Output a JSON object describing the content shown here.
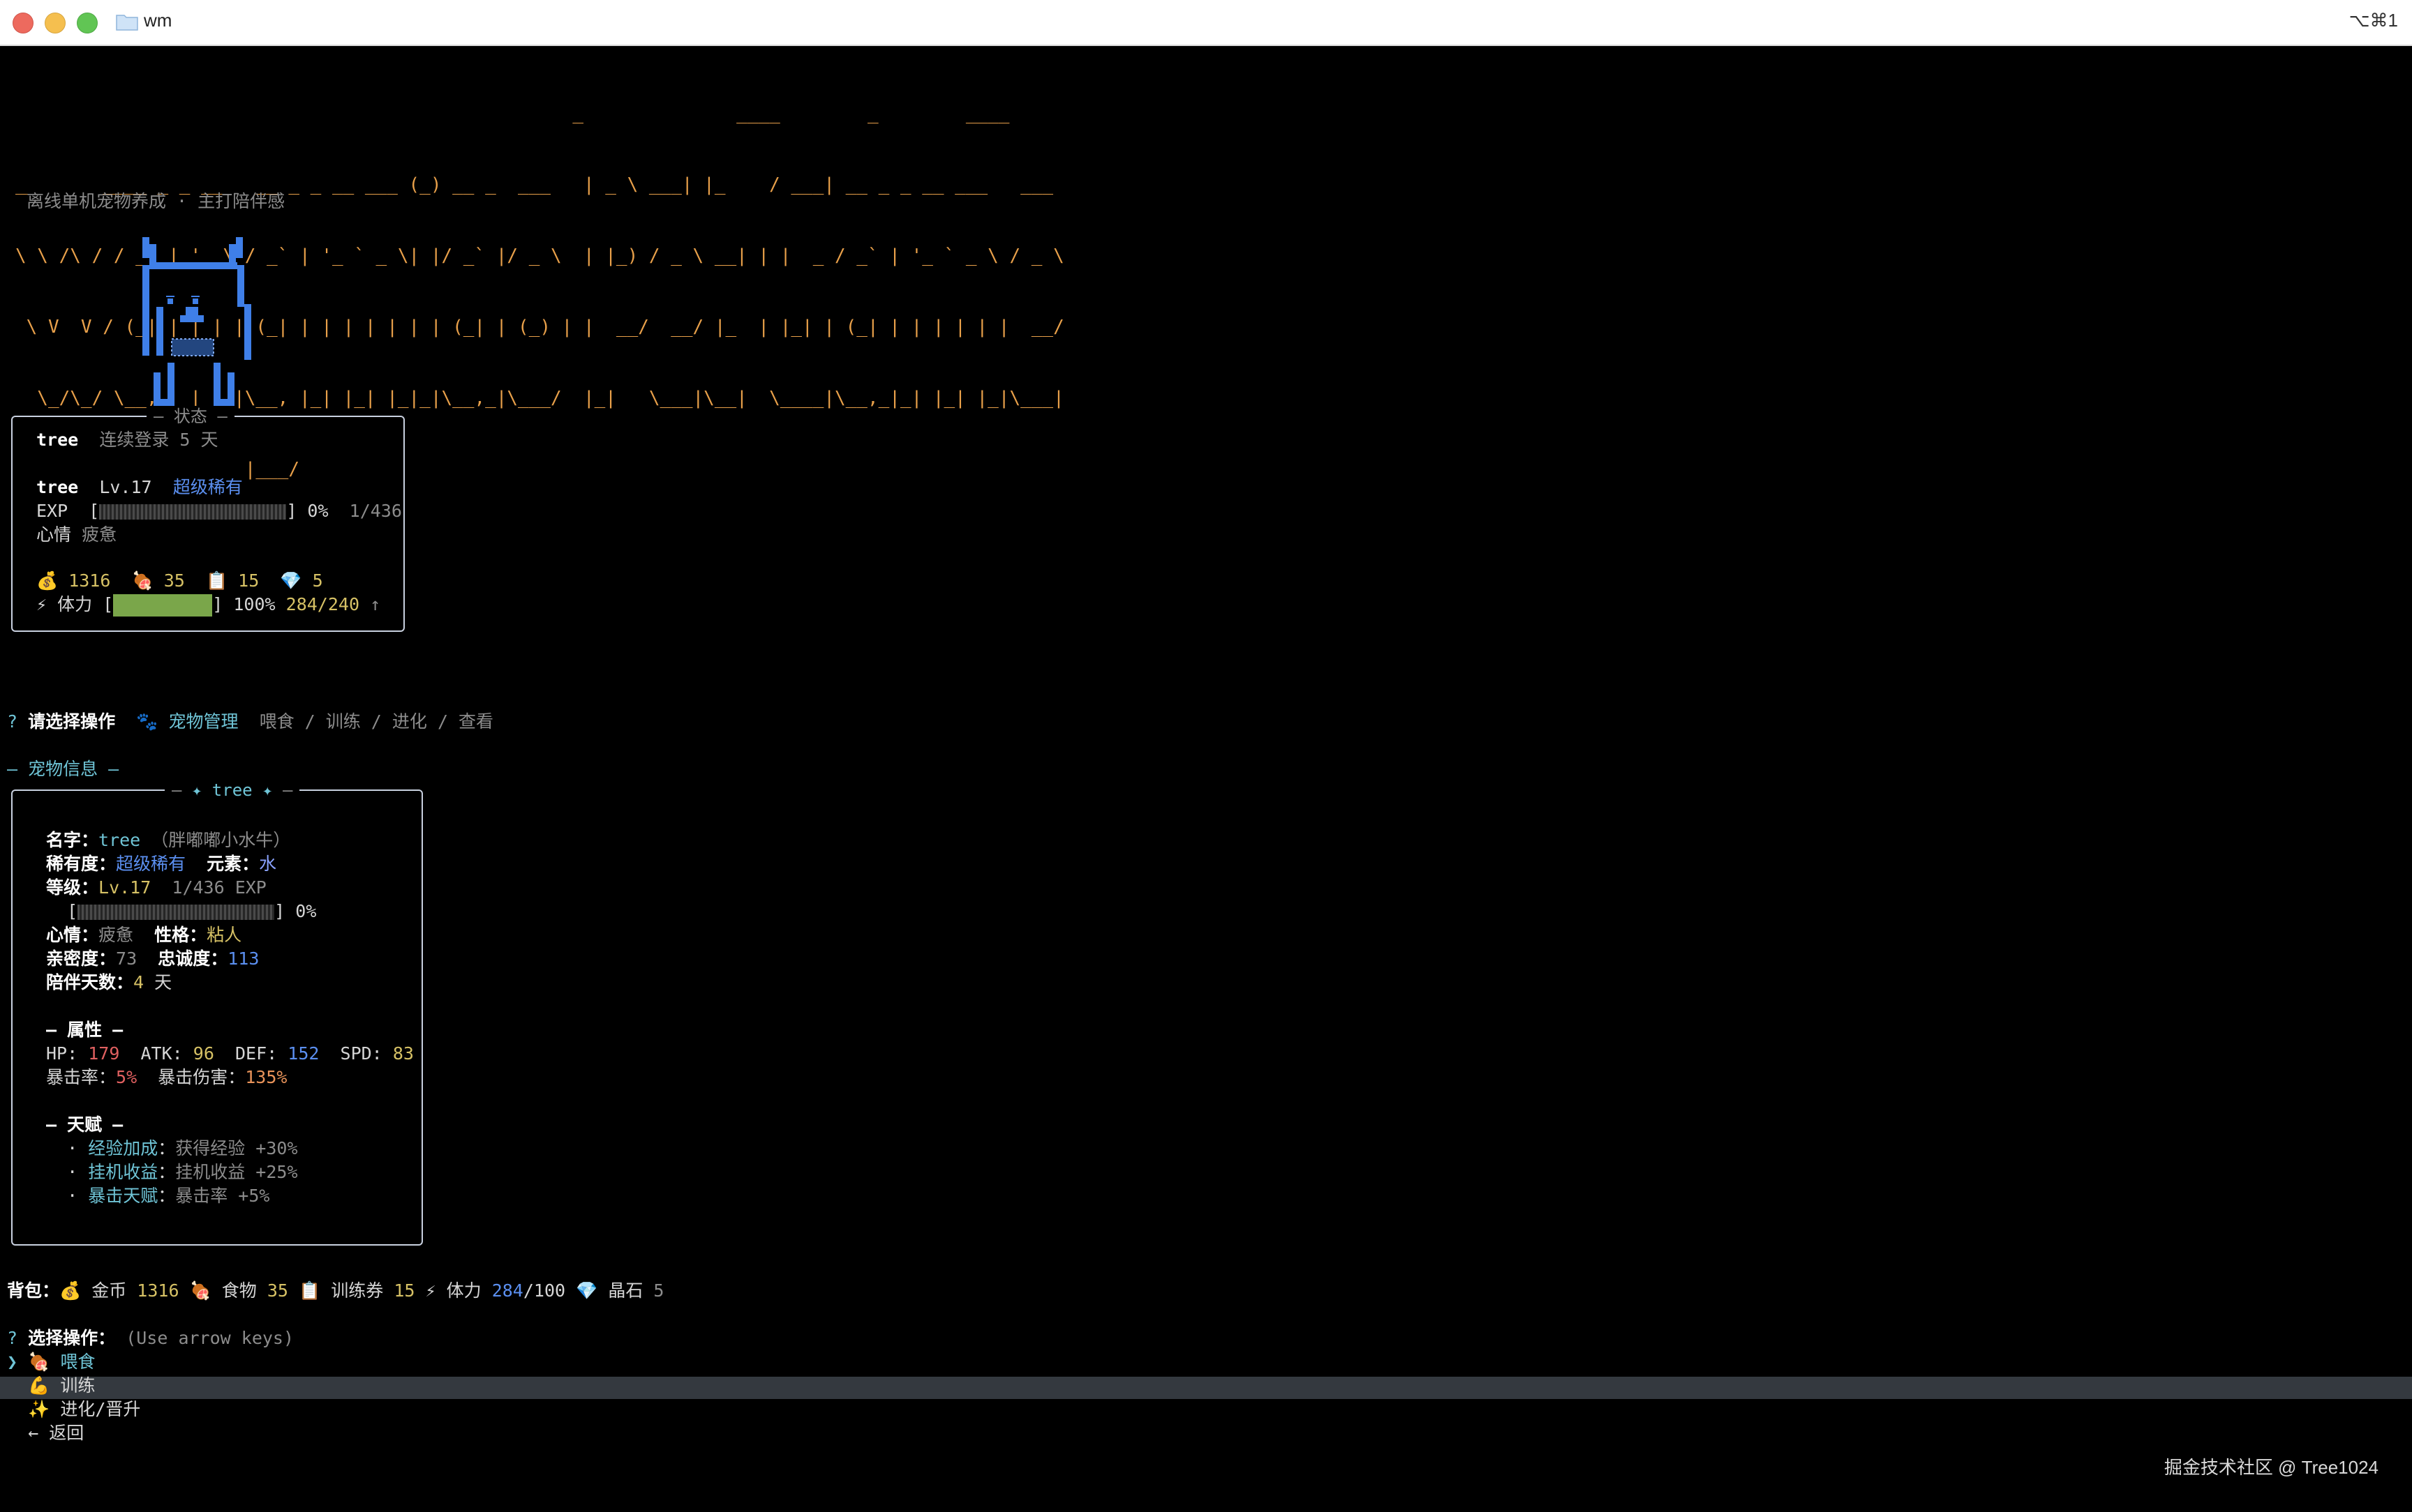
{
  "window": {
    "title": "wm",
    "shortcut": "⌥⌘1"
  },
  "banner": {
    "ascii_lines": [
      "                                                   _              ____        _        ____",
      "__      ____ _ _ __   __ _ _ __ ___ (_) __ _  ___   | _ \\ ___| |_    / ___| __ _ _ __ ___   ___",
      "\\ \\ /\\ / / _` | '_ \\ / _` | '_ ` _ \\| |/ _` |/ _ \\  | |_) / _ \\ __| | |  _ / _` | '_ ` _ \\ / _ \\",
      " \\ V  V / (_| | | | | (_| | | | | | | | (_| | (_) | |  __/  __/ |_  | |_| | (_| | | | | | |  __/",
      "  \\_/\\_/ \\__,_|_| |_|\\__, |_| |_| |_|_|\\__,_|\\___/  |_|   \\___|\\__|  \\____|\\__,_|_| |_| |_|\\___|",
      "                     |___/"
    ],
    "subtitle": "离线单机宠物养成 · 主打陪伴感"
  },
  "status_box": {
    "title": "状态",
    "user": "tree",
    "login_label": "连续登录 5 天",
    "pet_name": "tree",
    "level": "Lv.17",
    "rarity": "超级稀有",
    "exp_label": "EXP",
    "exp_pct": "0%",
    "exp_progress": 0.002,
    "exp_value": "1/436",
    "mood_label": "心情",
    "mood_value": "疲惫",
    "coins_icon": "money-bag-icon",
    "coins": "1316",
    "food_icon": "meat-icon",
    "food": "35",
    "ticket_icon": "clipboard-icon",
    "tickets": "15",
    "gem_icon": "gem-icon",
    "gems": "5",
    "stamina_icon": "lightning-icon",
    "stamina_label": "体力",
    "stamina_pct": "100%",
    "stamina_progress": 1.0,
    "stamina_value": "284/240",
    "stamina_arrow": "↑"
  },
  "prompt1": {
    "question_mark": "?",
    "label": "请选择操作",
    "answer_icon": "paw-icon",
    "answer": "宠物管理",
    "hint": "喂食 / 训练 / 进化 / 查看"
  },
  "section_header": "— 宠物信息 —",
  "pet_box": {
    "title": "✦ tree ✦",
    "name_label": "名字：",
    "name": "tree",
    "species": "（胖嘟嘟小水牛）",
    "rarity_label": "稀有度：",
    "rarity": "超级稀有",
    "element_label": "元素：",
    "element": "水",
    "level_label": "等级：",
    "level": "Lv.17",
    "exp": "1/436 EXP",
    "exp_pct": "0%",
    "mood_label": "心情：",
    "mood": "疲惫",
    "personality_label": "性格：",
    "personality": "粘人",
    "intimacy_label": "亲密度：",
    "intimacy": "73",
    "loyalty_label": "忠诚度：",
    "loyalty": "113",
    "days_label": "陪伴天数：",
    "days": "4",
    "days_unit": "天",
    "attr_header": "— 属性 —",
    "hp_label": "HP:",
    "hp": "179",
    "atk_label": "ATK:",
    "atk": "96",
    "def_label": "DEF:",
    "def": "152",
    "spd_label": "SPD:",
    "spd": "83",
    "crit_label": "暴击率：",
    "crit": "5%",
    "critdmg_label": "暴击伤害：",
    "critdmg": "135%",
    "talent_header": "— 天赋 —",
    "talents": [
      {
        "name": "经验加成",
        "desc": "获得经验 +30%"
      },
      {
        "name": "挂机收益",
        "desc": "挂机收益 +25%"
      },
      {
        "name": "暴击天赋",
        "desc": "暴击率 +5%"
      }
    ]
  },
  "backpack": {
    "label": "背包：",
    "coins_label": "金币",
    "coins": "1316",
    "food_label": "食物",
    "food": "35",
    "tickets_label": "训练券",
    "tickets": "15",
    "stamina_label": "体力",
    "stamina_cur": "284",
    "stamina_max": "/100",
    "gems_label": "晶石",
    "gems": "5"
  },
  "prompt2": {
    "question_mark": "?",
    "label": "选择操作：",
    "hint": "(Use arrow keys)"
  },
  "menu": [
    {
      "pointer": "❯",
      "icon": "meat-icon",
      "glyph": "🍖",
      "label": "喂食"
    },
    {
      "pointer": "",
      "icon": "muscle-icon",
      "glyph": "💪",
      "label": "训练"
    },
    {
      "pointer": "",
      "icon": "sparkles-icon",
      "glyph": "✨",
      "label": "进化/晋升"
    },
    {
      "pointer": "",
      "icon": "left-arrow-icon",
      "glyph": "←",
      "label": "返回"
    }
  ],
  "watermark": "掘金技术社区 @ Tree1024",
  "colors": {
    "banner": "#e8a04a",
    "pet": "#3f7fe8",
    "accent_blue": "#5b8ff0",
    "stamina_bar": "#7aa64a"
  }
}
